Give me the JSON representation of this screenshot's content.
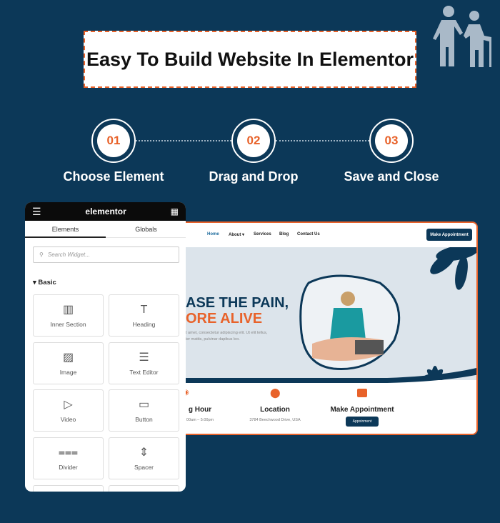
{
  "title": "Easy To Build Website In Elementor",
  "steps": [
    {
      "num": "01",
      "label": "Choose Element"
    },
    {
      "num": "02",
      "label": "Drag and Drop"
    },
    {
      "num": "03",
      "label": "Save and Close"
    }
  ],
  "site": {
    "nav": [
      "Home",
      "About ▾",
      "Services",
      "Blog",
      "Contact Us"
    ],
    "cta": "Make Appointment",
    "hero_line1": "ASE THE PAIN,",
    "hero_line2": "ORE ALIVE",
    "hero_text1": "t amet, consectetur adipiscing elit. Ut elit tellus,",
    "hero_text2": "ier mattis, pulvinar dapibus leo.",
    "cards": [
      {
        "title": "g Hour",
        "sub": "00am – 5:00pm",
        "icon": "clock-24-icon"
      },
      {
        "title": "Location",
        "sub": "3784 Beechwood Drive, USA",
        "icon": "map-pin-icon"
      },
      {
        "title": "Make Appointment",
        "button": "Appoinment",
        "icon": "calendar-check-icon"
      }
    ],
    "accent": "#e8622a",
    "brand": "#0c3858"
  },
  "panel": {
    "logo": "elementor",
    "tabs": [
      "Elements",
      "Globals"
    ],
    "search_placeholder": "Search Widget...",
    "section": "Basic",
    "widgets": [
      {
        "label": "Inner Section",
        "icon": "columns-icon"
      },
      {
        "label": "Heading",
        "icon": "heading-T-icon"
      },
      {
        "label": "Image",
        "icon": "image-icon"
      },
      {
        "label": "Text Editor",
        "icon": "text-lines-icon"
      },
      {
        "label": "Video",
        "icon": "video-play-icon"
      },
      {
        "label": "Button",
        "icon": "button-cursor-icon"
      },
      {
        "label": "Divider",
        "icon": "divider-icon"
      },
      {
        "label": "Spacer",
        "icon": "spacer-icon"
      }
    ]
  }
}
